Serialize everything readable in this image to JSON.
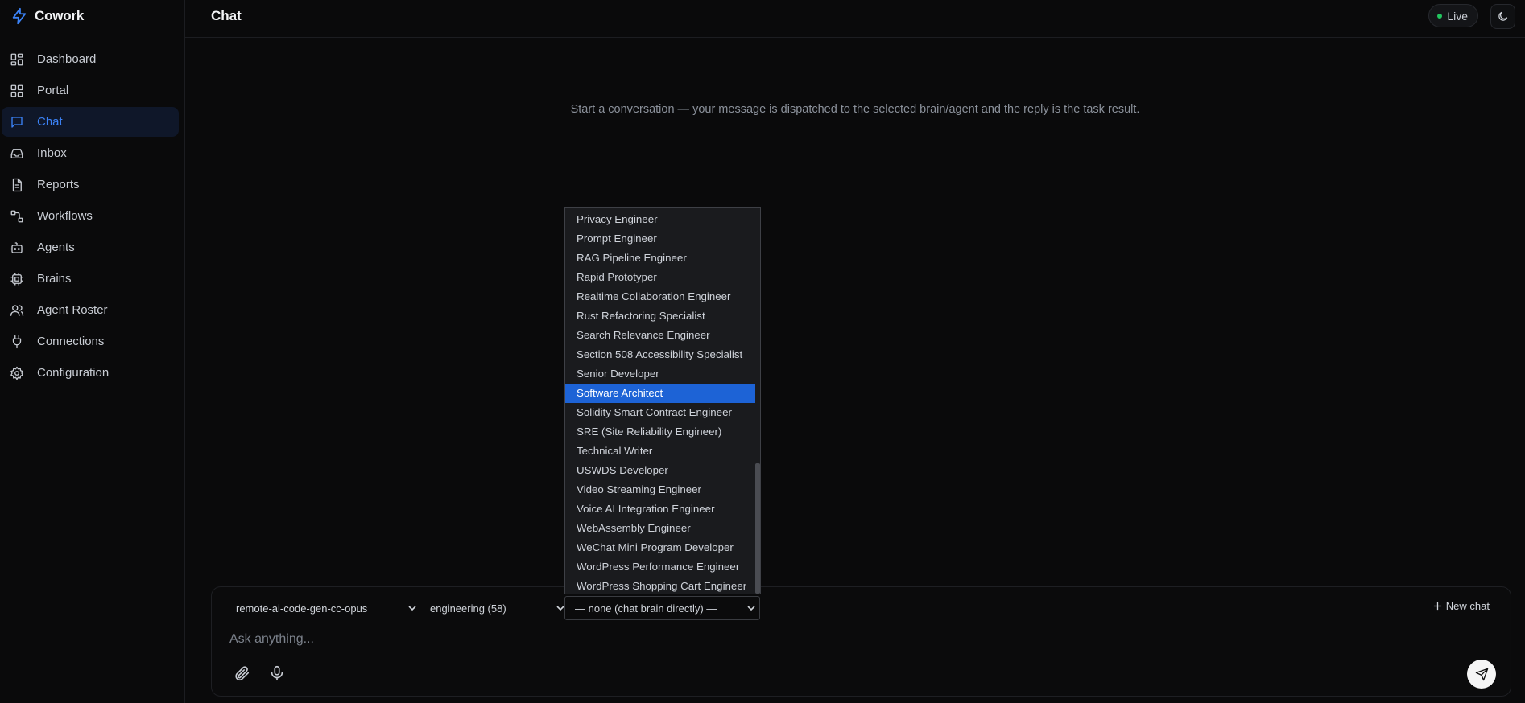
{
  "app": {
    "name": "Cowork"
  },
  "sidebar": {
    "items": [
      {
        "label": "Dashboard",
        "icon": "dashboard-icon"
      },
      {
        "label": "Portal",
        "icon": "portal-icon"
      },
      {
        "label": "Chat",
        "icon": "chat-icon",
        "active": true
      },
      {
        "label": "Inbox",
        "icon": "inbox-icon"
      },
      {
        "label": "Reports",
        "icon": "reports-icon"
      },
      {
        "label": "Workflows",
        "icon": "workflows-icon"
      },
      {
        "label": "Agents",
        "icon": "bot-icon"
      },
      {
        "label": "Brains",
        "icon": "cpu-icon"
      },
      {
        "label": "Agent Roster",
        "icon": "users-icon"
      },
      {
        "label": "Connections",
        "icon": "plug-icon"
      },
      {
        "label": "Configuration",
        "icon": "gear-icon"
      }
    ]
  },
  "header": {
    "title": "Chat",
    "live_label": "Live"
  },
  "main": {
    "empty_message": "Start a conversation — your message is dispatched to the selected brain/agent and the reply is the task result."
  },
  "composer": {
    "model_select": "remote-ai-code-gen-cc-opus",
    "department_select": "engineering (58)",
    "agent_select": "— none (chat brain directly) —",
    "new_chat_label": "New chat",
    "placeholder": "Ask anything..."
  },
  "agent_dropdown": {
    "options": [
      "Privacy Engineer",
      "Prompt Engineer",
      "RAG Pipeline Engineer",
      "Rapid Prototyper",
      "Realtime Collaboration Engineer",
      "Rust Refactoring Specialist",
      "Search Relevance Engineer",
      "Section 508 Accessibility Specialist",
      "Senior Developer",
      "Software Architect",
      "Solidity Smart Contract Engineer",
      "SRE (Site Reliability Engineer)",
      "Technical Writer",
      "USWDS Developer",
      "Video Streaming Engineer",
      "Voice AI Integration Engineer",
      "WebAssembly Engineer",
      "WeChat Mini Program Developer",
      "WordPress Performance Engineer",
      "WordPress Shopping Cart Engineer"
    ],
    "highlighted": "Software Architect"
  },
  "colors": {
    "accent": "#3b82f6",
    "live_dot": "#22c55e",
    "selection": "#1d63d6"
  }
}
